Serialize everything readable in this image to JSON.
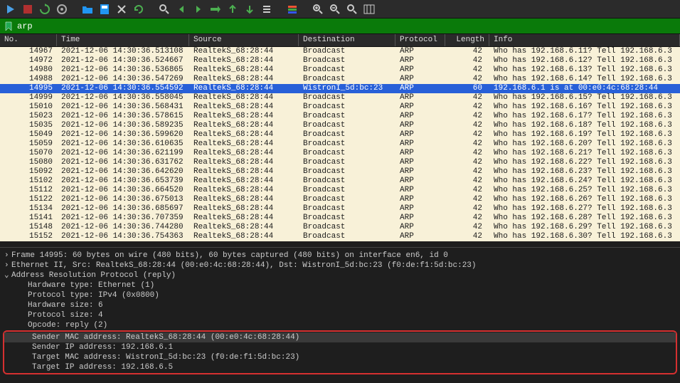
{
  "filter": {
    "value": "arp"
  },
  "columns": {
    "no": "No.",
    "time": "Time",
    "source": "Source",
    "destination": "Destination",
    "protocol": "Protocol",
    "length": "Length",
    "info": "Info"
  },
  "packets": [
    {
      "no": "14967",
      "time": "2021-12-06 14:30:36.513108",
      "src": "RealtekS_68:28:44",
      "dst": "Broadcast",
      "proto": "ARP",
      "len": "42",
      "info": "Who has 192.168.6.11? Tell 192.168.6.3",
      "sel": false
    },
    {
      "no": "14972",
      "time": "2021-12-06 14:30:36.524667",
      "src": "RealtekS_68:28:44",
      "dst": "Broadcast",
      "proto": "ARP",
      "len": "42",
      "info": "Who has 192.168.6.12? Tell 192.168.6.3",
      "sel": false
    },
    {
      "no": "14980",
      "time": "2021-12-06 14:30:36.536865",
      "src": "RealtekS_68:28:44",
      "dst": "Broadcast",
      "proto": "ARP",
      "len": "42",
      "info": "Who has 192.168.6.13? Tell 192.168.6.3",
      "sel": false
    },
    {
      "no": "14988",
      "time": "2021-12-06 14:30:36.547269",
      "src": "RealtekS_68:28:44",
      "dst": "Broadcast",
      "proto": "ARP",
      "len": "42",
      "info": "Who has 192.168.6.14? Tell 192.168.6.3",
      "sel": false
    },
    {
      "no": "14995",
      "time": "2021-12-06 14:30:36.554592",
      "src": "RealtekS_68:28:44",
      "dst": "WistronI_5d:bc:23",
      "proto": "ARP",
      "len": "60",
      "info": "192.168.6.1 is at 00:e0:4c:68:28:44",
      "sel": true
    },
    {
      "no": "14999",
      "time": "2021-12-06 14:30:36.558045",
      "src": "RealtekS_68:28:44",
      "dst": "Broadcast",
      "proto": "ARP",
      "len": "42",
      "info": "Who has 192.168.6.15? Tell 192.168.6.3",
      "sel": false
    },
    {
      "no": "15010",
      "time": "2021-12-06 14:30:36.568431",
      "src": "RealtekS_68:28:44",
      "dst": "Broadcast",
      "proto": "ARP",
      "len": "42",
      "info": "Who has 192.168.6.16? Tell 192.168.6.3",
      "sel": false
    },
    {
      "no": "15023",
      "time": "2021-12-06 14:30:36.578615",
      "src": "RealtekS_68:28:44",
      "dst": "Broadcast",
      "proto": "ARP",
      "len": "42",
      "info": "Who has 192.168.6.17? Tell 192.168.6.3",
      "sel": false
    },
    {
      "no": "15035",
      "time": "2021-12-06 14:30:36.589235",
      "src": "RealtekS_68:28:44",
      "dst": "Broadcast",
      "proto": "ARP",
      "len": "42",
      "info": "Who has 192.168.6.18? Tell 192.168.6.3",
      "sel": false
    },
    {
      "no": "15049",
      "time": "2021-12-06 14:30:36.599620",
      "src": "RealtekS_68:28:44",
      "dst": "Broadcast",
      "proto": "ARP",
      "len": "42",
      "info": "Who has 192.168.6.19? Tell 192.168.6.3",
      "sel": false
    },
    {
      "no": "15059",
      "time": "2021-12-06 14:30:36.610635",
      "src": "RealtekS_68:28:44",
      "dst": "Broadcast",
      "proto": "ARP",
      "len": "42",
      "info": "Who has 192.168.6.20? Tell 192.168.6.3",
      "sel": false
    },
    {
      "no": "15070",
      "time": "2021-12-06 14:30:36.621199",
      "src": "RealtekS_68:28:44",
      "dst": "Broadcast",
      "proto": "ARP",
      "len": "42",
      "info": "Who has 192.168.6.21? Tell 192.168.6.3",
      "sel": false
    },
    {
      "no": "15080",
      "time": "2021-12-06 14:30:36.631762",
      "src": "RealtekS_68:28:44",
      "dst": "Broadcast",
      "proto": "ARP",
      "len": "42",
      "info": "Who has 192.168.6.22? Tell 192.168.6.3",
      "sel": false
    },
    {
      "no": "15092",
      "time": "2021-12-06 14:30:36.642620",
      "src": "RealtekS_68:28:44",
      "dst": "Broadcast",
      "proto": "ARP",
      "len": "42",
      "info": "Who has 192.168.6.23? Tell 192.168.6.3",
      "sel": false
    },
    {
      "no": "15102",
      "time": "2021-12-06 14:30:36.653739",
      "src": "RealtekS_68:28:44",
      "dst": "Broadcast",
      "proto": "ARP",
      "len": "42",
      "info": "Who has 192.168.6.24? Tell 192.168.6.3",
      "sel": false
    },
    {
      "no": "15112",
      "time": "2021-12-06 14:30:36.664520",
      "src": "RealtekS_68:28:44",
      "dst": "Broadcast",
      "proto": "ARP",
      "len": "42",
      "info": "Who has 192.168.6.25? Tell 192.168.6.3",
      "sel": false
    },
    {
      "no": "15122",
      "time": "2021-12-06 14:30:36.675013",
      "src": "RealtekS_68:28:44",
      "dst": "Broadcast",
      "proto": "ARP",
      "len": "42",
      "info": "Who has 192.168.6.26? Tell 192.168.6.3",
      "sel": false
    },
    {
      "no": "15134",
      "time": "2021-12-06 14:30:36.685697",
      "src": "RealtekS_68:28:44",
      "dst": "Broadcast",
      "proto": "ARP",
      "len": "42",
      "info": "Who has 192.168.6.27? Tell 192.168.6.3",
      "sel": false
    },
    {
      "no": "15141",
      "time": "2021-12-06 14:30:36.707359",
      "src": "RealtekS_68:28:44",
      "dst": "Broadcast",
      "proto": "ARP",
      "len": "42",
      "info": "Who has 192.168.6.28? Tell 192.168.6.3",
      "sel": false
    },
    {
      "no": "15148",
      "time": "2021-12-06 14:30:36.744280",
      "src": "RealtekS_68:28:44",
      "dst": "Broadcast",
      "proto": "ARP",
      "len": "42",
      "info": "Who has 192.168.6.29? Tell 192.168.6.3",
      "sel": false
    },
    {
      "no": "15152",
      "time": "2021-12-06 14:30:36.754363",
      "src": "RealtekS_68:28:44",
      "dst": "Broadcast",
      "proto": "ARP",
      "len": "42",
      "info": "Who has 192.168.6.30? Tell 192.168.6.3",
      "sel": false
    }
  ],
  "details": {
    "frame": "Frame 14995: 60 bytes on wire (480 bits), 60 bytes captured (480 bits) on interface en6, id 0",
    "eth": "Ethernet II, Src: RealtekS_68:28:44 (00:e0:4c:68:28:44), Dst: WistronI_5d:bc:23 (f0:de:f1:5d:bc:23)",
    "arp_header": "Address Resolution Protocol (reply)",
    "hw_type": "Hardware type: Ethernet (1)",
    "proto_type": "Protocol type: IPv4 (0x0800)",
    "hw_size": "Hardware size: 6",
    "proto_size": "Protocol size: 4",
    "opcode": "Opcode: reply (2)",
    "sender_mac": "Sender MAC address: RealtekS_68:28:44 (00:e0:4c:68:28:44)",
    "sender_ip": "Sender IP address: 192.168.6.1",
    "target_mac": "Target MAC address: WistronI_5d:bc:23 (f0:de:f1:5d:bc:23)",
    "target_ip": "Target IP address: 192.168.6.5"
  }
}
